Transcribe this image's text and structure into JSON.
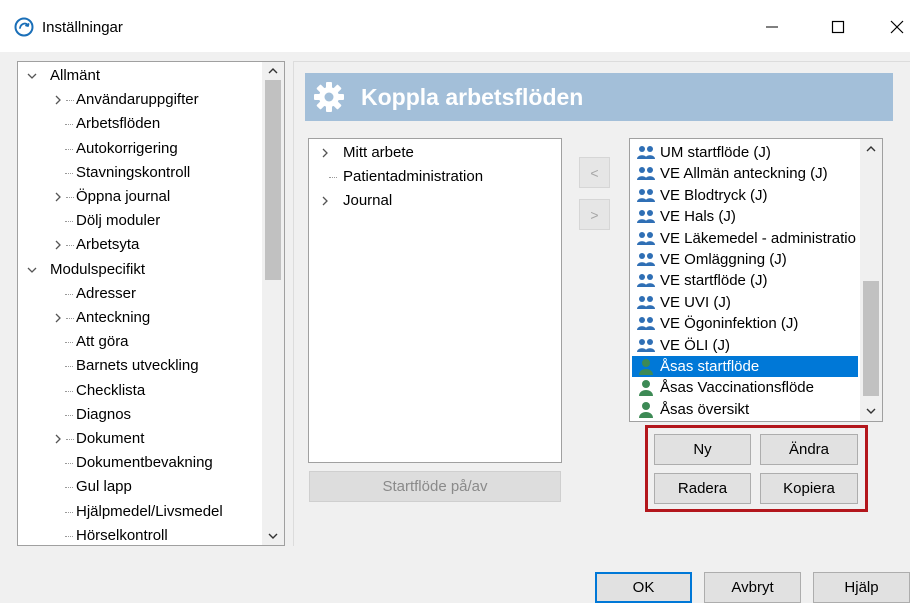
{
  "window": {
    "title": "Inställningar",
    "minimize_label": "—",
    "maximize_label": "☐",
    "close_label": "✕"
  },
  "tree": {
    "items": [
      {
        "label": "Allmänt",
        "level": 0,
        "expander": "expanded"
      },
      {
        "label": "Användaruppgifter",
        "level": 1,
        "expander": "collapsed"
      },
      {
        "label": "Arbetsflöden",
        "level": 1,
        "expander": "none"
      },
      {
        "label": "Autokorrigering",
        "level": 1,
        "expander": "none"
      },
      {
        "label": "Stavningskontroll",
        "level": 1,
        "expander": "none"
      },
      {
        "label": "Öppna journal",
        "level": 1,
        "expander": "collapsed"
      },
      {
        "label": "Dölj moduler",
        "level": 1,
        "expander": "none"
      },
      {
        "label": "Arbetsyta",
        "level": 1,
        "expander": "collapsed"
      },
      {
        "label": "Modulspecifikt",
        "level": 0,
        "expander": "expanded"
      },
      {
        "label": "Adresser",
        "level": 1,
        "expander": "none"
      },
      {
        "label": "Anteckning",
        "level": 1,
        "expander": "collapsed"
      },
      {
        "label": "Att göra",
        "level": 1,
        "expander": "none"
      },
      {
        "label": "Barnets utveckling",
        "level": 1,
        "expander": "none"
      },
      {
        "label": "Checklista",
        "level": 1,
        "expander": "none"
      },
      {
        "label": "Diagnos",
        "level": 1,
        "expander": "none"
      },
      {
        "label": "Dokument",
        "level": 1,
        "expander": "collapsed"
      },
      {
        "label": "Dokumentbevakning",
        "level": 1,
        "expander": "none"
      },
      {
        "label": "Gul lapp",
        "level": 1,
        "expander": "none"
      },
      {
        "label": "Hjälpmedel/Livsmedel",
        "level": 1,
        "expander": "none"
      },
      {
        "label": "Hörselkontroll",
        "level": 1,
        "expander": "none"
      }
    ]
  },
  "header": {
    "title": "Koppla arbetsflöden",
    "icon": "gear-icon"
  },
  "left_list": {
    "items": [
      {
        "label": "Mitt arbete",
        "expander": "collapsed"
      },
      {
        "label": "Patientadministration",
        "expander": "none"
      },
      {
        "label": "Journal",
        "expander": "collapsed"
      }
    ]
  },
  "move_buttons": {
    "left": "<",
    "right": ">"
  },
  "right_list": {
    "items": [
      {
        "label": "UM startflöde (J)",
        "icon": "group-icon",
        "selected": false
      },
      {
        "label": "VE Allmän anteckning (J)",
        "icon": "group-icon",
        "selected": false
      },
      {
        "label": "VE Blodtryck (J)",
        "icon": "group-icon",
        "selected": false
      },
      {
        "label": "VE Hals (J)",
        "icon": "group-icon",
        "selected": false
      },
      {
        "label": "VE Läkemedel - administratio",
        "icon": "group-icon",
        "selected": false
      },
      {
        "label": "VE Omläggning (J)",
        "icon": "group-icon",
        "selected": false
      },
      {
        "label": "VE startflöde (J)",
        "icon": "group-icon",
        "selected": false
      },
      {
        "label": "VE UVI (J)",
        "icon": "group-icon",
        "selected": false
      },
      {
        "label": "VE Ögoninfektion (J)",
        "icon": "group-icon",
        "selected": false
      },
      {
        "label": "VE ÖLI (J)",
        "icon": "group-icon",
        "selected": false
      },
      {
        "label": "Åsas startflöde",
        "icon": "person-icon",
        "selected": true
      },
      {
        "label": "Åsas Vaccinationsflöde",
        "icon": "person-icon",
        "selected": false
      },
      {
        "label": "Åsas översikt",
        "icon": "person-icon",
        "selected": false
      }
    ]
  },
  "buttons": {
    "startflode": "Startflöde på/av",
    "ny": "Ny",
    "andra": "Ändra",
    "radera": "Radera",
    "kopiera": "Kopiera"
  },
  "footer": {
    "ok": "OK",
    "avbryt": "Avbryt",
    "hjalp": "Hjälp"
  },
  "colors": {
    "header_bg": "#a3bfd9",
    "selection": "#0078d7",
    "group_icon": "#2f6fb5",
    "person_icon": "#3d8a55",
    "highlight_box": "#b3161c"
  }
}
